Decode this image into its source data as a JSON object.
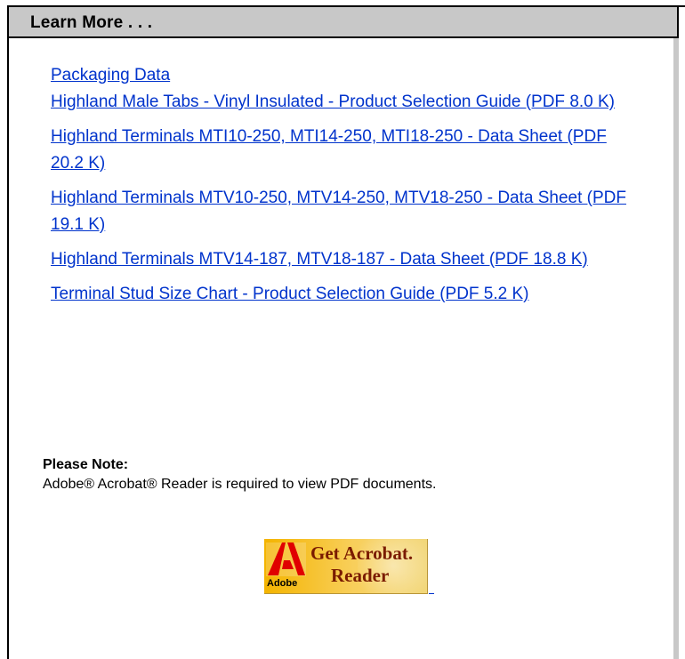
{
  "panel": {
    "title": "Learn More . . ."
  },
  "links": [
    "Packaging Data",
    "Highland Male Tabs - Vinyl Insulated - Product Selection Guide (PDF 8.0 K)",
    "Highland Terminals MTI10-250, MTI14-250, MTI18-250 - Data Sheet (PDF 20.2 K)",
    "Highland Terminals MTV10-250, MTV14-250, MTV18-250 - Data Sheet (PDF 19.1 K)",
    "Highland Terminals MTV14-187, MTV18-187 - Data Sheet (PDF 18.8 K)",
    "Terminal Stud Size Chart - Product Selection Guide (PDF 5.2 K)"
  ],
  "note": {
    "title": "Please Note:",
    "text": "Adobe® Acrobat® Reader is required to view PDF documents."
  },
  "acrobat_badge": {
    "adobe": "Adobe",
    "line1": "Get Acrobat.",
    "line2": "Reader"
  },
  "colors": {
    "link": "#0033cc",
    "header_bg": "#c8c8c8",
    "badge_bg": "#f4b400",
    "badge_text": "#7a1b00"
  }
}
